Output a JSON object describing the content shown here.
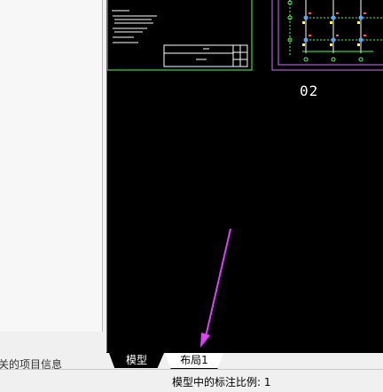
{
  "left_panel": {
    "footer_text": "关的项目信息"
  },
  "drawing": {
    "sheet_label": "02"
  },
  "tabs": [
    {
      "label": "模型",
      "active": true
    },
    {
      "label": "布局1",
      "active": false
    }
  ],
  "status_bar": {
    "text": "模型中的标注比例: 1"
  },
  "colors": {
    "canvas_bg": "#000000",
    "frame_green": "#55ff55",
    "frame_magenta": "#d070ff",
    "arrow": "#e040ff"
  }
}
